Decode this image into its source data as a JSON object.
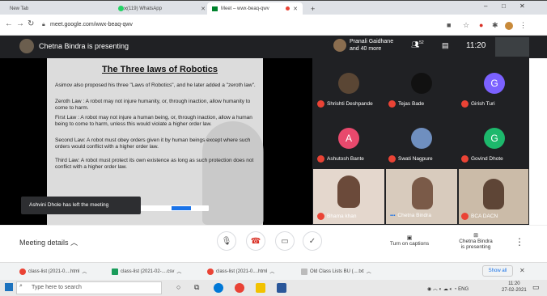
{
  "browser": {
    "tabs": [
      {
        "label": "New Tab"
      },
      {
        "label": "(119) WhatsApp"
      },
      {
        "label": "Meet – wwx-beaq-qwv"
      }
    ],
    "new_tab": "+",
    "url": "meet.google.com/wwx-beaq-qwv",
    "window_controls": {
      "minimize": "–",
      "restore": "□",
      "close": "✕"
    }
  },
  "meet": {
    "presenting_label": "Chetna Bindra is presenting",
    "host_line1": "Pranali Gaidhane",
    "host_line2": "and 40 more",
    "participant_count": "52",
    "clock": "11:20",
    "slide": {
      "title": "The Three laws of Robotics",
      "paragraphs": [
        "Asimov also proposed his three \"Laws of Robotics\", and he later added a \"zeroth law\".",
        "Zeroth Law : A robot may not injure humanity, or, through inaction, allow humanity to come to harm.",
        "First Law : A robot may not injure a human being, or, through inaction, allow a human being to come to harm, unless this would violate a higher order law.",
        "Second Law: A robot must obey orders given it by human beings except where such orders would conflict with a higher order law.",
        "Third Law: A robot must protect its own existence as long as such protection does not conflict with a higher order law."
      ]
    },
    "toast": "Ashvini Dhole has left the meeting",
    "participants": [
      {
        "name": "Shrishti Deshpande",
        "initial": "",
        "color": "#5a4634"
      },
      {
        "name": "Tejas Bade",
        "initial": "",
        "color": "#111111"
      },
      {
        "name": "Girish Turi",
        "initial": "G",
        "color": "#7b61ff"
      },
      {
        "name": "Ashutosh Bante",
        "initial": "A",
        "color": "#e8496d"
      },
      {
        "name": "Swati Nagpure",
        "initial": "",
        "color": "#6f8fbf"
      },
      {
        "name": "Govind Dhote",
        "initial": "G",
        "color": "#1db86c"
      }
    ],
    "videos": [
      {
        "name": "Bhama khan"
      },
      {
        "name": "Chetna Bindra"
      },
      {
        "name": "BCA DACN"
      }
    ],
    "controls": {
      "meeting_details": "Meeting details",
      "captions": "Turn on captions",
      "presenting_line1": "Chetna Bindra",
      "presenting_line2": "is presenting"
    }
  },
  "downloads": {
    "items": [
      {
        "label": "class-list (2021-0....html"
      },
      {
        "label": "class-list (2021-02-....csv"
      },
      {
        "label": "class-list (2021-0....html"
      },
      {
        "label": "Old Class Lists BU (....txt"
      }
    ],
    "show_all": "Show all"
  },
  "taskbar": {
    "search_placeholder": "Type here to search",
    "lang": "ENG",
    "time": "11:20",
    "date": "27-02-2021"
  }
}
